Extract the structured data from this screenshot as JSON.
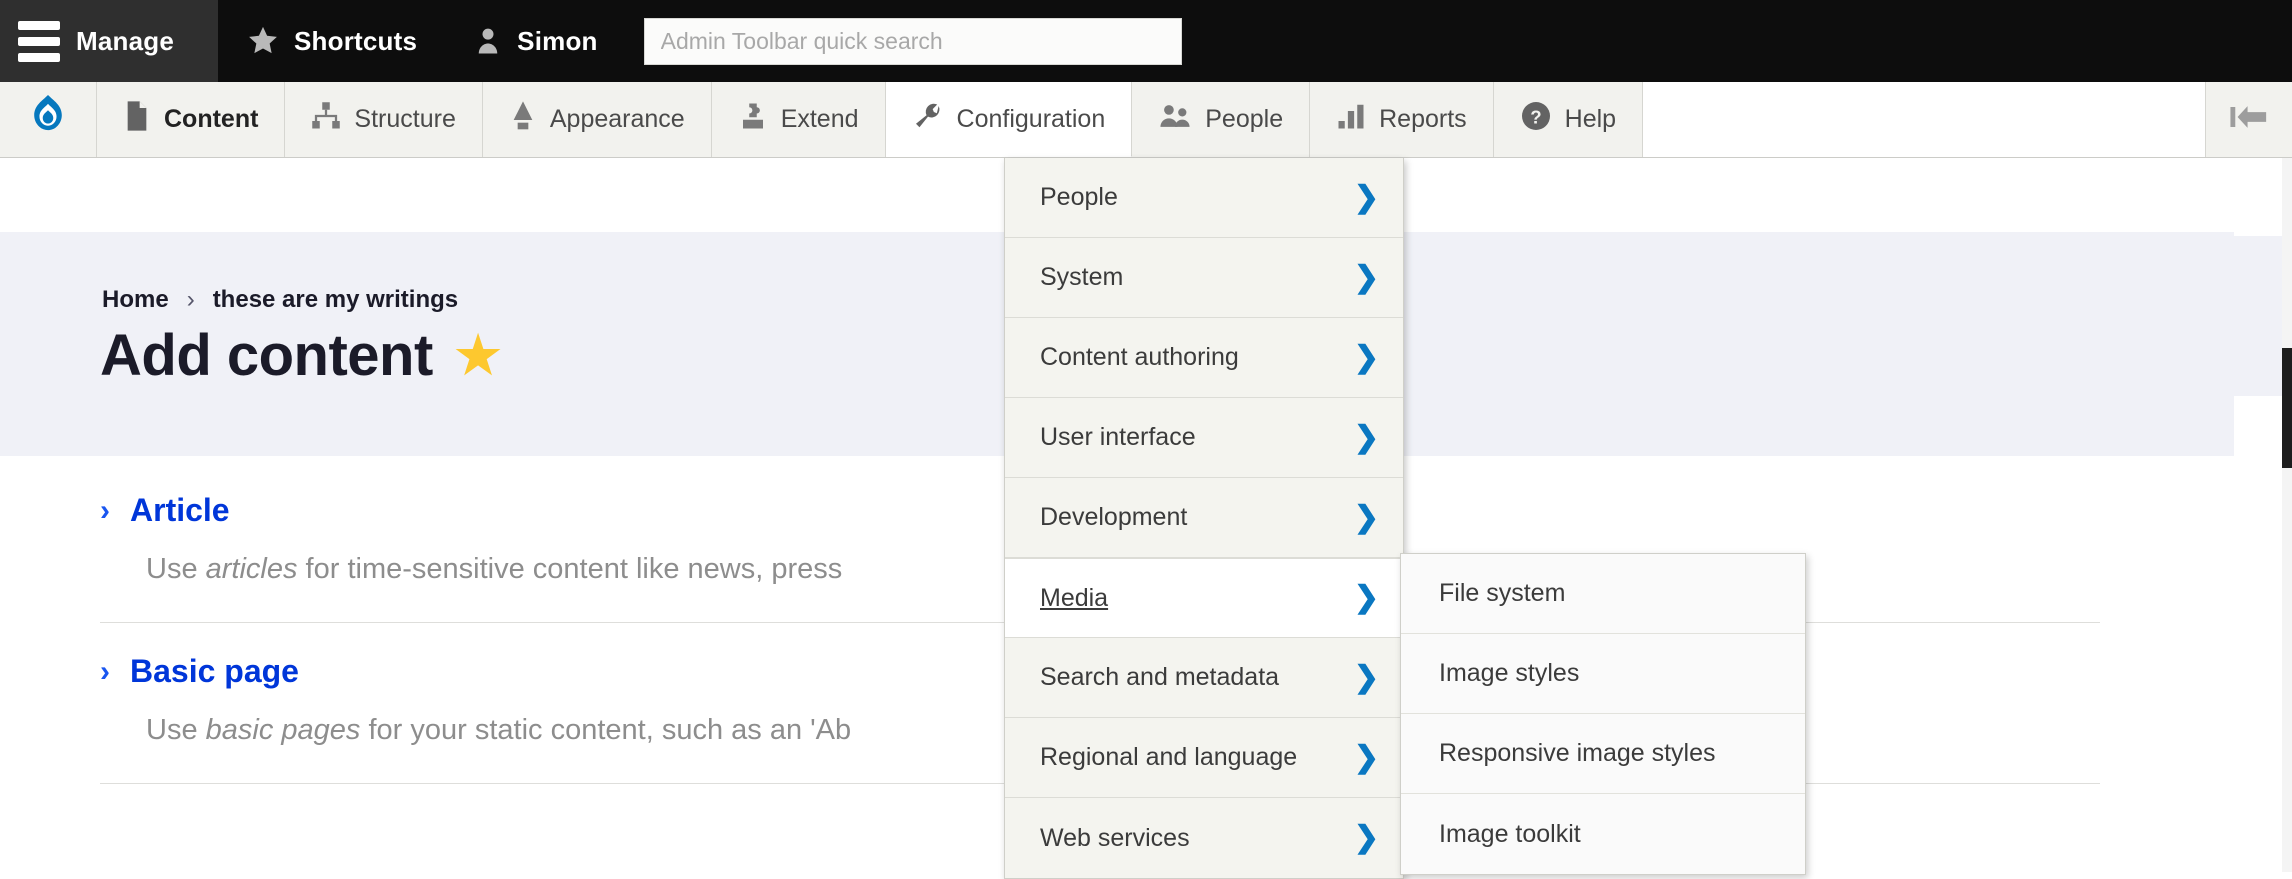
{
  "toolbar": {
    "manage_label": "Manage",
    "manage_icon": "hamburger-icon",
    "shortcuts_label": "Shortcuts",
    "shortcuts_icon": "star-icon",
    "user_label": "Simon",
    "user_icon": "person-icon",
    "search_placeholder": "Admin Toolbar quick search",
    "search_value": ""
  },
  "menu_bar": {
    "logo_icon": "drupal-drop-icon",
    "items": [
      {
        "label": "Content",
        "icon": "content-page-icon",
        "state": "active"
      },
      {
        "label": "Structure",
        "icon": "structure-icon",
        "state": "normal"
      },
      {
        "label": "Appearance",
        "icon": "appearance-brush-icon",
        "state": "normal"
      },
      {
        "label": "Extend",
        "icon": "extend-puzzle-icon",
        "state": "normal"
      },
      {
        "label": "Configuration",
        "icon": "configuration-wrench-icon",
        "state": "open"
      },
      {
        "label": "People",
        "icon": "people-icon",
        "state": "normal"
      },
      {
        "label": "Reports",
        "icon": "reports-bars-icon",
        "state": "normal"
      },
      {
        "label": "Help",
        "icon": "help-question-icon",
        "state": "normal"
      }
    ],
    "tray_icon": "collapse-left-arrow-icon"
  },
  "dropdown": {
    "parent": "Configuration",
    "items": [
      {
        "label": "People",
        "open": false
      },
      {
        "label": "System",
        "open": false
      },
      {
        "label": "Content authoring",
        "open": false
      },
      {
        "label": "User interface",
        "open": false
      },
      {
        "label": "Development",
        "open": false
      },
      {
        "label": "Media",
        "open": true
      },
      {
        "label": "Search and metadata",
        "open": false
      },
      {
        "label": "Regional and language",
        "open": false
      },
      {
        "label": "Web services",
        "open": false
      }
    ],
    "chevron_icon": "chevron-right-icon",
    "chevron_color": "#0a77c1"
  },
  "submenu": {
    "parent": "Media",
    "items": [
      {
        "label": "File system"
      },
      {
        "label": "Image styles"
      },
      {
        "label": "Responsive image styles"
      },
      {
        "label": "Image toolkit"
      }
    ]
  },
  "page": {
    "breadcrumb": {
      "home": "Home",
      "separator": "›",
      "current": "these are my writings"
    },
    "title": "Add content",
    "star_icon": "favorite-star-icon",
    "star_color": "#fdc82f"
  },
  "content_types": [
    {
      "name": "Article",
      "desc_before": "Use ",
      "desc_em": "articles",
      "desc_after": " for time-sensitive content like news, press"
    },
    {
      "name": "Basic page",
      "desc_before": "Use ",
      "desc_em": "basic pages",
      "desc_after": " for your static content, such as an 'Ab"
    }
  ],
  "colors": {
    "link_blue": "#0036d9",
    "chevron_blue": "#0a77c1",
    "toolbar_dark": "#0d0d0d",
    "manage_gray": "#2f2f2f",
    "menu_bg": "#f2f2ee",
    "band_bg": "#f0f1f7"
  }
}
